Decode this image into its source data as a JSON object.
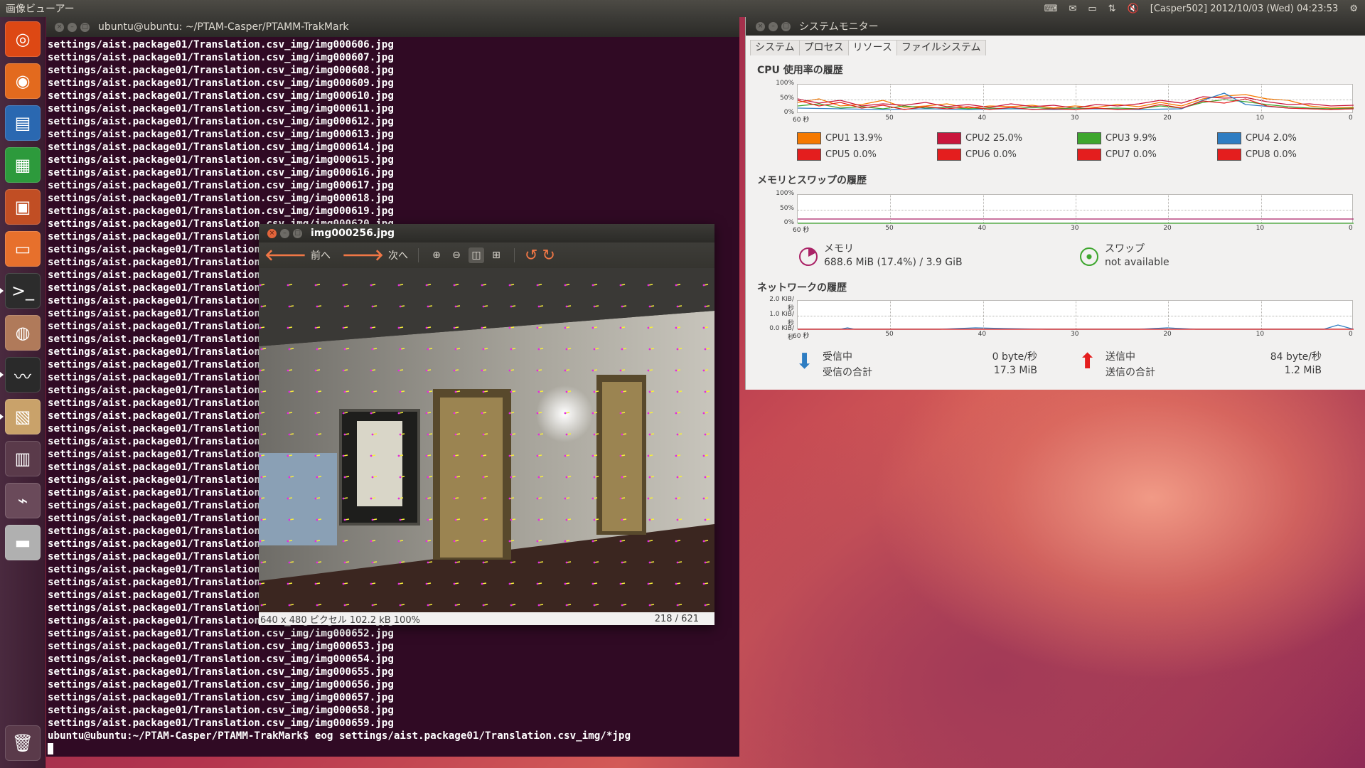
{
  "top_panel": {
    "app_title": "画像ビューアー",
    "clock": "[Casper502] 2012/10/03 (Wed) 04:23:53",
    "indicators": [
      "keyboard-icon",
      "mail-icon",
      "battery-icon",
      "network-icon",
      "volume-muted-icon",
      "gear-icon"
    ]
  },
  "launcher": {
    "items": [
      {
        "name": "ubuntu-dash-icon",
        "glyph": "◎",
        "bg": "#dd4814"
      },
      {
        "name": "firefox-icon",
        "glyph": "◉",
        "bg": "#e36a1e"
      },
      {
        "name": "writer-icon",
        "glyph": "▤",
        "bg": "#2a68b1"
      },
      {
        "name": "calc-icon",
        "glyph": "▦",
        "bg": "#2d9a3c"
      },
      {
        "name": "impress-icon",
        "glyph": "▣",
        "bg": "#c14e24"
      },
      {
        "name": "files-icon",
        "glyph": "▭",
        "bg": "#e7702c"
      },
      {
        "name": "terminal-icon",
        "glyph": ">_",
        "bg": "#2c2c2c"
      },
      {
        "name": "software-center-icon",
        "glyph": "◍",
        "bg": "#b07a5a"
      },
      {
        "name": "system-monitor-icon",
        "glyph": "〰",
        "bg": "#2a2a2a"
      },
      {
        "name": "image-viewer-icon",
        "glyph": "▧",
        "bg": "#c9a26a"
      },
      {
        "name": "workspace-switcher-icon",
        "glyph": "▥",
        "bg": "#5a3a4a"
      },
      {
        "name": "usb-drive-icon",
        "glyph": "⌁",
        "bg": "#6a4a5a"
      },
      {
        "name": "disk-drive-icon",
        "glyph": "▬",
        "bg": "#b0b0b0"
      },
      {
        "name": "trash-icon",
        "glyph": "🗑",
        "bg": "#5a3a4a"
      }
    ]
  },
  "terminal": {
    "title": "ubuntu@ubuntu: ~/PTAM-Casper/PTAMM-TrakMark",
    "line_prefix": "settings/aist.package01/Translation.csv_img/img000",
    "first_index": 606,
    "last_index": 659,
    "prompt": "ubuntu@ubuntu:~/PTAM-Casper/PTAMM-TrakMark$ eog settings/aist.package01/Translation.csv_img/*jpg"
  },
  "system_monitor": {
    "title": "システムモニター",
    "tabs": [
      "システム",
      "プロセス",
      "リソース",
      "ファイルシステム"
    ],
    "selected_tab": 2,
    "cpu": {
      "title": "CPU 使用率の履歴",
      "y_ticks": [
        "100%",
        "50%",
        "0%"
      ],
      "x_ticks": [
        "60 秒",
        "50",
        "40",
        "30",
        "20",
        "10",
        "0"
      ],
      "legend": [
        {
          "label": "CPU1",
          "value": "13.9%",
          "color": "#f57900"
        },
        {
          "label": "CPU2",
          "value": "25.0%",
          "color": "#c9163c"
        },
        {
          "label": "CPU3",
          "value": "9.9%",
          "color": "#3ea62e"
        },
        {
          "label": "CPU4",
          "value": "2.0%",
          "color": "#2e7dc2"
        },
        {
          "label": "CPU5",
          "value": "0.0%",
          "color": "#e41e1e"
        },
        {
          "label": "CPU6",
          "value": "0.0%",
          "color": "#e41e1e"
        },
        {
          "label": "CPU7",
          "value": "0.0%",
          "color": "#e41e1e"
        },
        {
          "label": "CPU8",
          "value": "0.0%",
          "color": "#e41e1e"
        }
      ]
    },
    "memory": {
      "title": "メモリとスワップの履歴",
      "y_ticks": [
        "100%",
        "50%",
        "0%"
      ],
      "x_ticks": [
        "60 秒",
        "50",
        "40",
        "30",
        "20",
        "10",
        "0"
      ],
      "mem_label": "メモリ",
      "mem_value": "688.6 MiB (17.4%) / 3.9 GiB",
      "swap_label": "スワップ",
      "swap_value": "not available"
    },
    "network": {
      "title": "ネットワークの履歴",
      "y_ticks": [
        "2.0 KiB/秒",
        "1.0 KiB/秒",
        "0.0 KiB/秒"
      ],
      "x_ticks": [
        "60 秒",
        "50",
        "40",
        "30",
        "20",
        "10",
        "0"
      ],
      "recv_label": "受信中",
      "recv_total_label": "受信の合計",
      "recv_rate": "0 byte/秒",
      "recv_total": "17.3 MiB",
      "send_label": "送信中",
      "send_total_label": "送信の合計",
      "send_rate": "84 byte/秒",
      "send_total": "1.2 MiB"
    }
  },
  "image_viewer": {
    "title": "img000256.jpg",
    "prev_label": "前へ",
    "next_label": "次へ",
    "status_size": "640 x 480 ピクセル  102.2 kB   100%",
    "status_page": "218 / 621"
  }
}
